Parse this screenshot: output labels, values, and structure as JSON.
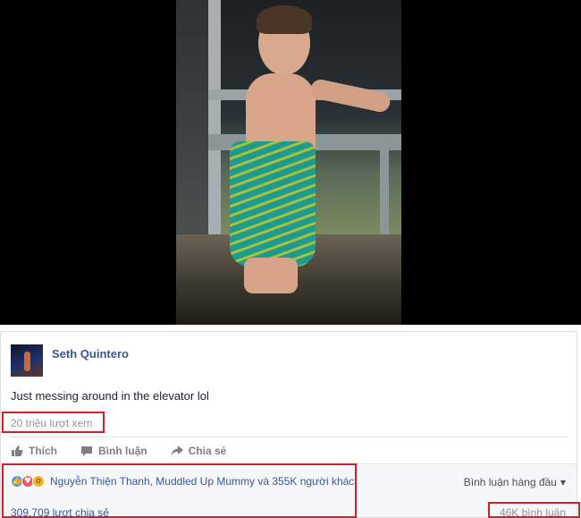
{
  "post": {
    "author": "Seth Quintero",
    "caption": "Just messing around in the elevator lol",
    "views": "20 triệu lượt xem"
  },
  "actions": {
    "like": "Thích",
    "comment": "Bình luận",
    "share": "Chia sẻ"
  },
  "reactions": {
    "icons": [
      "like-icon",
      "love-icon",
      "wow-icon"
    ],
    "summary": "Nguyễn Thiện Thanh, Muddled Up Mummy và 355K người khác",
    "sort": "Bình luận hàng đầu",
    "shares": "309.709 lượt chia sẻ",
    "comments": "46K bình luận"
  },
  "colors": {
    "link": "#365899",
    "muted": "#90949c",
    "highlight": "#d31f2a"
  }
}
